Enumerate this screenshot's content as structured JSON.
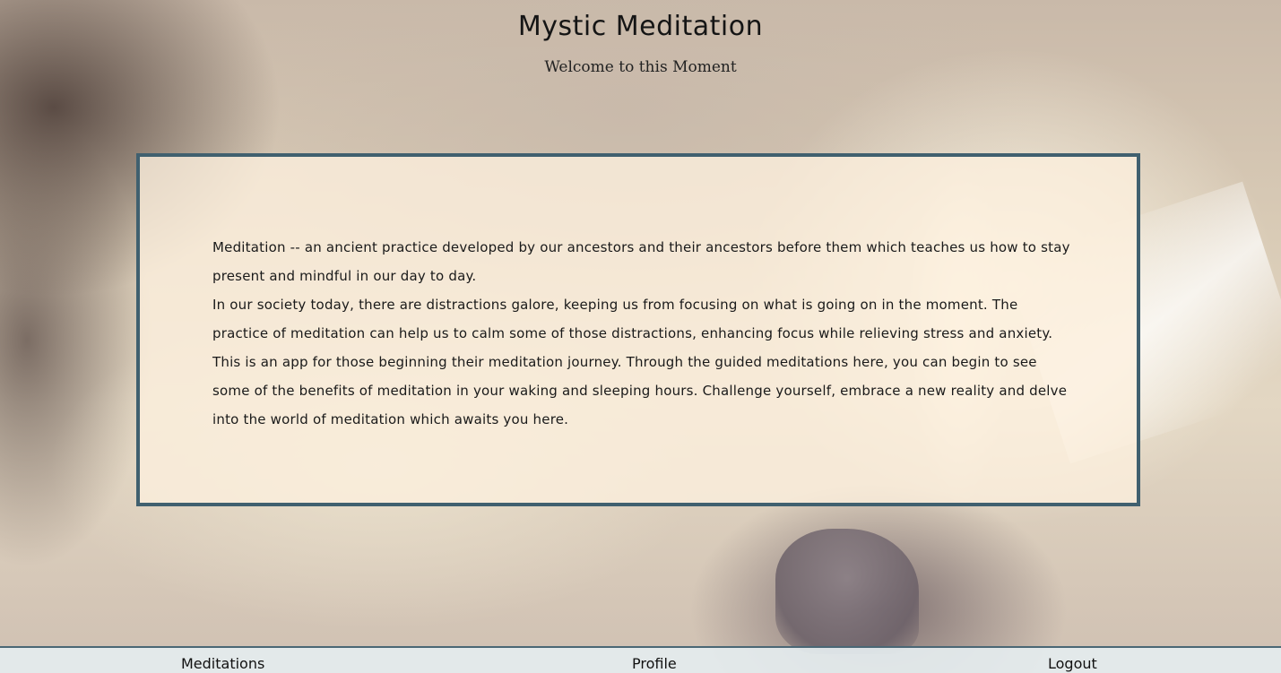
{
  "header": {
    "title": "Mystic Meditation",
    "subtitle": "Welcome to this Moment"
  },
  "intro": {
    "paragraphs": [
      "Meditation -- an ancient practice developed by our ancestors and their ancestors before them which teaches us how to stay present and mindful in our day to day.",
      "In our society today, there are distractions galore, keeping us from focusing on what is going on in the moment. The practice of meditation can help us to calm some of those distractions, enhancing focus while relieving stress and anxiety. This is an app for those beginning their meditation journey. Through the guided meditations here, you can begin to see some of the benefits of meditation in your waking and sleeping hours. Challenge yourself, embrace a new reality and delve into the world of meditation which awaits you here."
    ]
  },
  "footer_nav": {
    "meditations": "Meditations",
    "profile": "Profile",
    "logout": "Logout"
  },
  "colors": {
    "card_border": "#40606f",
    "card_background": "#fdf0de",
    "nav_background": "#e4ecee"
  }
}
